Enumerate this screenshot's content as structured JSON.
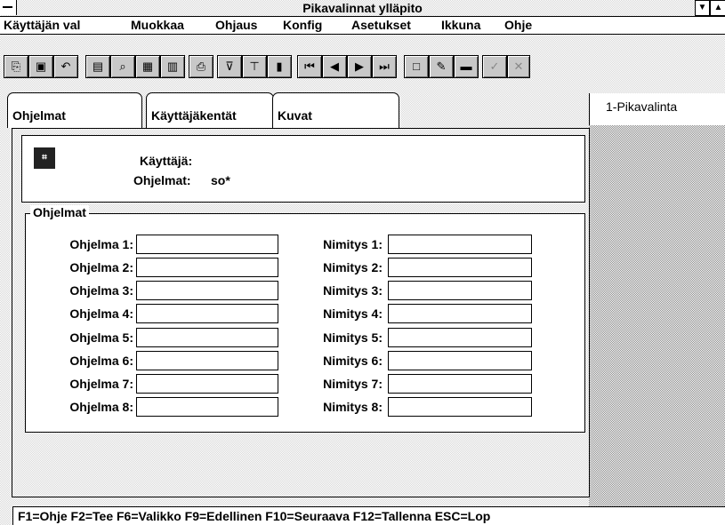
{
  "window": {
    "title": "Pikavalinnat ylläpito"
  },
  "menu": [
    "Käyttäjän val",
    "Muokkaa",
    "Ohjaus",
    "Konfig",
    "Asetukset",
    "Ikkuna",
    "Ohje"
  ],
  "toolbar": {
    "icons": [
      "copy-icon",
      "paste-icon",
      "undo-icon",
      "page-icon",
      "search-icon",
      "grid-icon",
      "table-icon",
      "print-icon",
      "filter-icon",
      "sort-icon",
      "chart-icon",
      "first-record-icon",
      "previous-record-icon",
      "next-record-icon",
      "last-record-icon",
      "new-record-icon",
      "edit-record-icon",
      "delete-record-icon",
      "accept-icon",
      "cancel-icon"
    ],
    "disabled_icons": [
      "accept-icon",
      "cancel-icon"
    ]
  },
  "tabs": [
    {
      "label": "Ohjelmat",
      "active": true
    },
    {
      "label": "Käyttäjäkentät",
      "active": false
    },
    {
      "label": "Kuvat",
      "active": false
    }
  ],
  "side_tab": {
    "label": "1-Pikavalinta"
  },
  "header": {
    "user_label": "Käyttäjä:",
    "user_value": "",
    "programs_label": "Ohjelmat:",
    "programs_value": "so*"
  },
  "group": {
    "title": "Ohjelmat",
    "rows": [
      {
        "program_label": "Ohjelma 1:",
        "program_value": "",
        "name_label": "Nimitys 1:",
        "name_value": ""
      },
      {
        "program_label": "Ohjelma 2:",
        "program_value": "",
        "name_label": "Nimitys 2:",
        "name_value": ""
      },
      {
        "program_label": "Ohjelma 3:",
        "program_value": "",
        "name_label": "Nimitys 3:",
        "name_value": ""
      },
      {
        "program_label": "Ohjelma 4:",
        "program_value": "",
        "name_label": "Nimitys 4:",
        "name_value": ""
      },
      {
        "program_label": "Ohjelma 5:",
        "program_value": "",
        "name_label": "Nimitys 5:",
        "name_value": ""
      },
      {
        "program_label": "Ohjelma 6:",
        "program_value": "",
        "name_label": "Nimitys 6:",
        "name_value": ""
      },
      {
        "program_label": "Ohjelma 7:",
        "program_value": "",
        "name_label": "Nimitys 7:",
        "name_value": ""
      },
      {
        "program_label": "Ohjelma 8:",
        "program_value": "",
        "name_label": "Nimitys 8:",
        "name_value": ""
      }
    ]
  },
  "status": {
    "text": "F1=Ohje  F2=Tee  F6=Valikko F9=Edellinen  F10=Seuraava  F12=Tallenna  ESC=Lop"
  }
}
